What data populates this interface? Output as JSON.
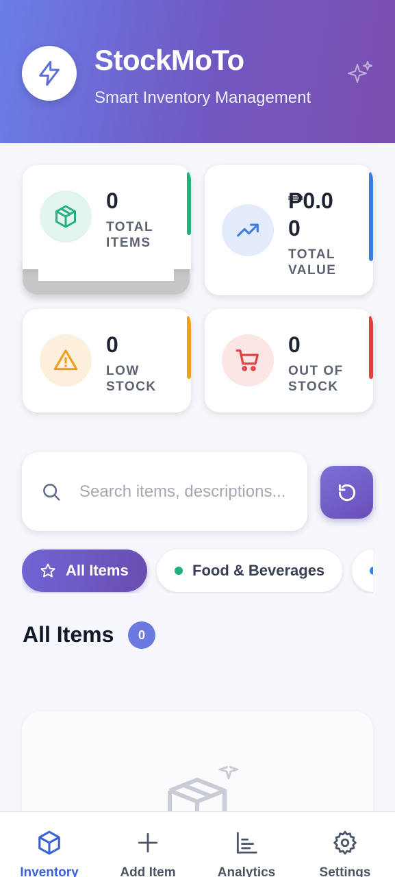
{
  "app": {
    "title": "StockMoTo",
    "subtitle": "Smart Inventory Management"
  },
  "stats": [
    {
      "value": "0",
      "label_line1": "TOTAL",
      "label_line2": "ITEMS",
      "accent": "#22b07d",
      "icon": "package-icon"
    },
    {
      "value_line1": "₱0.0",
      "value_line2": "0",
      "label_line1": "TOTAL",
      "label_line2": "VALUE",
      "accent": "#3b7de0",
      "icon": "trending-up-icon"
    },
    {
      "value": "0",
      "label_line1": "LOW",
      "label_line2": "STOCK",
      "accent": "#f0a020",
      "icon": "warning-icon"
    },
    {
      "value": "0",
      "label_line1": "OUT OF",
      "label_line2": "STOCK",
      "accent": "#e0413f",
      "icon": "cart-icon"
    }
  ],
  "search": {
    "placeholder": "Search items, descriptions..."
  },
  "filters": {
    "active_label": "All Items",
    "food_label": "Food & Beverages",
    "food_dot_color": "#22b07d",
    "more_dot_color": "#3b7de0"
  },
  "section": {
    "title": "All Items",
    "count": "0"
  },
  "nav": {
    "items": [
      {
        "label": "Inventory",
        "icon": "cube-icon",
        "active": true
      },
      {
        "label": "Add Item",
        "icon": "plus-icon",
        "active": false
      },
      {
        "label": "Analytics",
        "icon": "bar-chart-icon",
        "active": false
      },
      {
        "label": "Settings",
        "icon": "gear-icon",
        "active": false
      }
    ]
  },
  "colors": {
    "header_start": "#6a7ee8",
    "header_end": "#7a4fae",
    "accent": "#6a4fb8",
    "active_nav": "#3b63d4"
  }
}
